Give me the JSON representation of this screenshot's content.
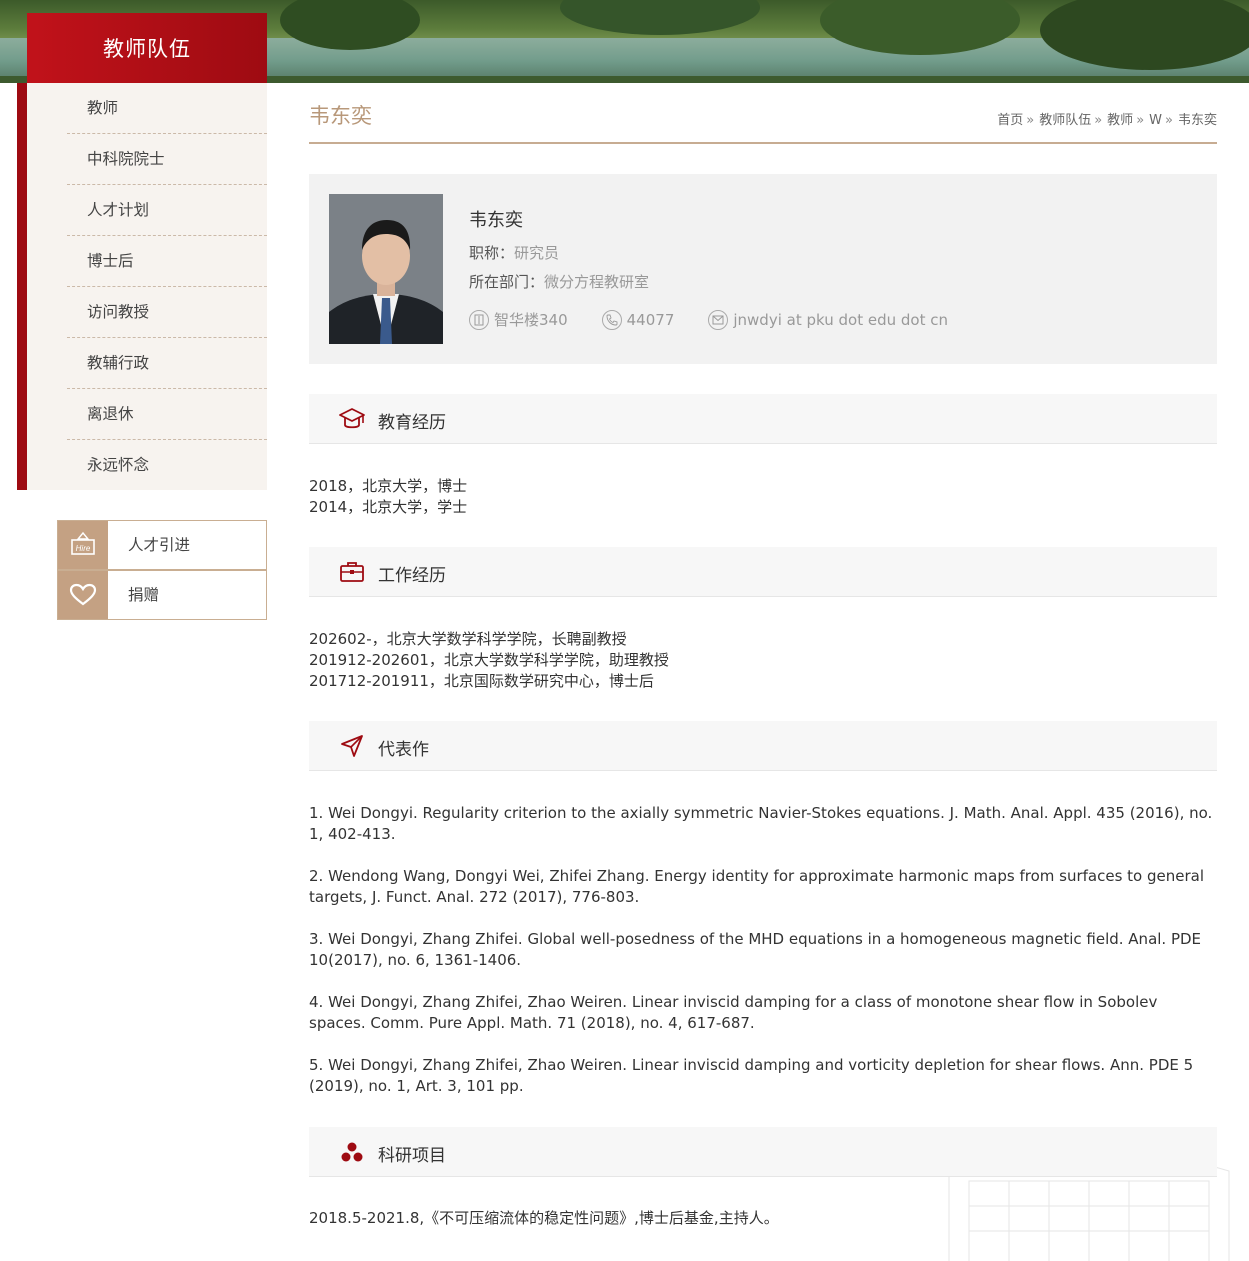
{
  "sidebar": {
    "title": "教师队伍",
    "items": [
      {
        "label": "教师"
      },
      {
        "label": "中科院院士"
      },
      {
        "label": "人才计划"
      },
      {
        "label": "博士后"
      },
      {
        "label": "访问教授"
      },
      {
        "label": "教辅行政"
      },
      {
        "label": "离退休"
      },
      {
        "label": "永远怀念"
      }
    ],
    "quick_links": [
      {
        "label": "人才引进",
        "icon": "hire-icon",
        "icon_text": "Hire"
      },
      {
        "label": "捐赠",
        "icon": "heart-icon"
      }
    ]
  },
  "page": {
    "title": "韦东奕",
    "breadcrumb": [
      {
        "label": "首页"
      },
      {
        "label": "教师队伍"
      },
      {
        "label": "教师"
      },
      {
        "label": "W"
      },
      {
        "label": "韦东奕"
      }
    ],
    "breadcrumb_sep": "»"
  },
  "profile": {
    "name": "韦东奕",
    "title_label": "职称：",
    "title_value": "研究员",
    "dept_label": "所在部门：",
    "dept_value": "微分方程教研室",
    "office": "智华楼340",
    "phone": "44077",
    "email": "jnwdyi at pku dot edu dot cn"
  },
  "sections": {
    "education": {
      "title": "教育经历",
      "icon": "graduation-cap-icon",
      "lines": [
        "2018，北京大学，博士",
        "2014，北京大学，学士"
      ]
    },
    "work": {
      "title": "工作经历",
      "icon": "briefcase-icon",
      "lines": [
        "202602-，北京大学数学科学学院，长聘副教授",
        "201912-202601，北京大学数学科学学院，助理教授",
        "201712-201911，北京国际数学研究中心，博士后"
      ]
    },
    "publications": {
      "title": "代表作",
      "icon": "paper-plane-icon",
      "items": [
        "1. Wei Dongyi. Regularity criterion to the axially symmetric Navier-Stokes equations. J. Math. Anal. Appl. 435 (2016), no. 1, 402-413.",
        "2. Wendong Wang, Dongyi Wei, Zhifei Zhang. Energy identity for approximate harmonic maps from surfaces to general targets, J. Funct. Anal. 272 (2017), 776-803.",
        "3. Wei Dongyi, Zhang Zhifei. Global well-posedness of the MHD equations in a homogeneous magnetic field. Anal. PDE 10(2017), no. 6, 1361-1406.",
        "4. Wei Dongyi, Zhang Zhifei, Zhao Weiren. Linear inviscid damping for a class of monotone shear flow in Sobolev spaces. Comm. Pure Appl. Math. 71 (2018), no. 4, 617-687.",
        "5. Wei Dongyi, Zhang Zhifei, Zhao Weiren. Linear inviscid damping and vorticity depletion for shear flows. Ann. PDE 5 (2019), no. 1, Art. 3, 101 pp."
      ]
    },
    "projects": {
      "title": "科研项目",
      "icon": "three-dots-icon",
      "lines": [
        "2018.5-2021.8,《不可压缩流体的稳定性问题》,博士后基金,主持人。"
      ]
    }
  },
  "colors": {
    "brand_red": "#9e0b12",
    "accent_tan": "#c4a183",
    "title_tan": "#b8987a"
  }
}
